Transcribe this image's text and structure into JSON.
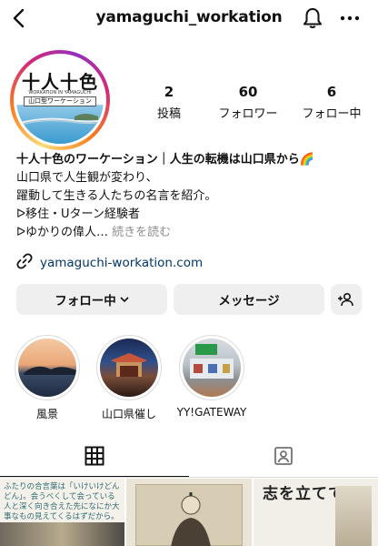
{
  "header": {
    "username": "yamaguchi_workation",
    "icons": [
      "back-icon",
      "bell-icon",
      "more-icon"
    ]
  },
  "profile": {
    "avatar_title": "十人十色",
    "avatar_subtitle": "WORKATION IN YAMAGUCHI",
    "avatar_tag": "山口型ワーケーション"
  },
  "stats": [
    {
      "value": "2",
      "label": "投稿"
    },
    {
      "value": "60",
      "label": "フォロワー"
    },
    {
      "value": "6",
      "label": "フォロー中"
    }
  ],
  "bio": {
    "name": "十人十色のワーケーション｜人生の転機は山口県から🌈",
    "line1": "山口県で人生観が変わり、",
    "line2": "躍動して生きる人たちの名言を紹介。",
    "line3": "ᐅ移住・Uターン経験者",
    "line4": "ᐅゆかりの偉人…",
    "more": "続きを読む"
  },
  "link": {
    "url": "yamaguchi-workation.com",
    "icon": "link-icon"
  },
  "buttons": {
    "following": "フォロー中",
    "message": "メッセージ",
    "suggest_icon": "add-person-icon"
  },
  "highlights": [
    {
      "label": "風景"
    },
    {
      "label": "山口県催し"
    },
    {
      "label": "YY!GATEWAY"
    }
  ],
  "tabs": [
    {
      "icon": "grid-icon",
      "active": true
    },
    {
      "icon": "tagged-icon",
      "active": false
    }
  ],
  "posts": {
    "post1_text": "ふたりの合言葉は「いけいけどんどん」。会うべくして会っている人と深く向き合えた先になにか大事なもの見えてくるはずだから。",
    "post3_text": "志を立てて"
  },
  "colors": {
    "link": "#00376b",
    "button_bg": "#efefef",
    "muted": "#8e8e8e"
  }
}
